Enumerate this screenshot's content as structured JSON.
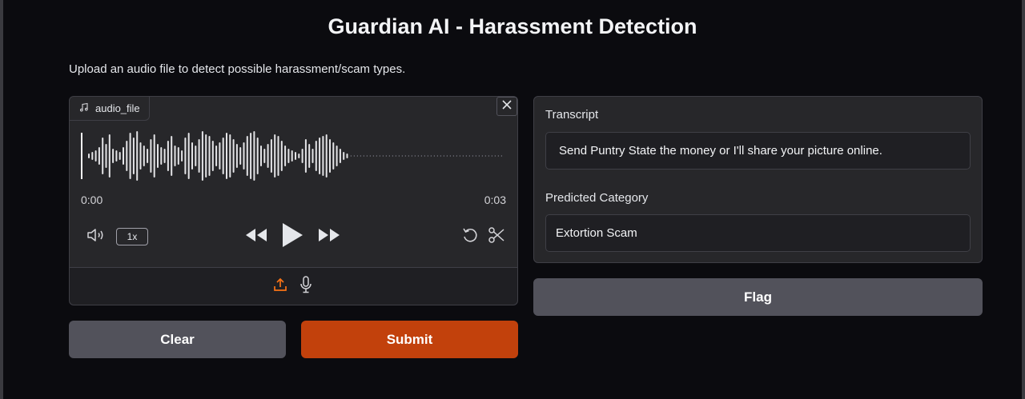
{
  "page": {
    "title": "Guardian AI - Harassment Detection",
    "description": "Upload an audio file to detect possible harassment/scam types."
  },
  "audio": {
    "label": "audio_file",
    "time_current": "0:00",
    "time_total": "0:03",
    "speed": "1x",
    "icons": [
      "music-note-icon",
      "close-icon",
      "volume-icon",
      "rewind-icon",
      "play-icon",
      "fast-forward-icon",
      "reset-icon",
      "scissors-icon",
      "upload-icon",
      "microphone-icon"
    ]
  },
  "buttons": {
    "clear": "Clear",
    "submit": "Submit",
    "flag": "Flag"
  },
  "outputs": {
    "transcript_label": "Transcript",
    "transcript_value": "Send Puntry State the money or I'll share your picture online.",
    "category_label": "Predicted Category",
    "category_value": "Extortion Scam"
  },
  "colors": {
    "accent": "#c2410c",
    "secondary_button": "#52525b",
    "background": "#0b0b0f",
    "panel": "#27272a"
  }
}
